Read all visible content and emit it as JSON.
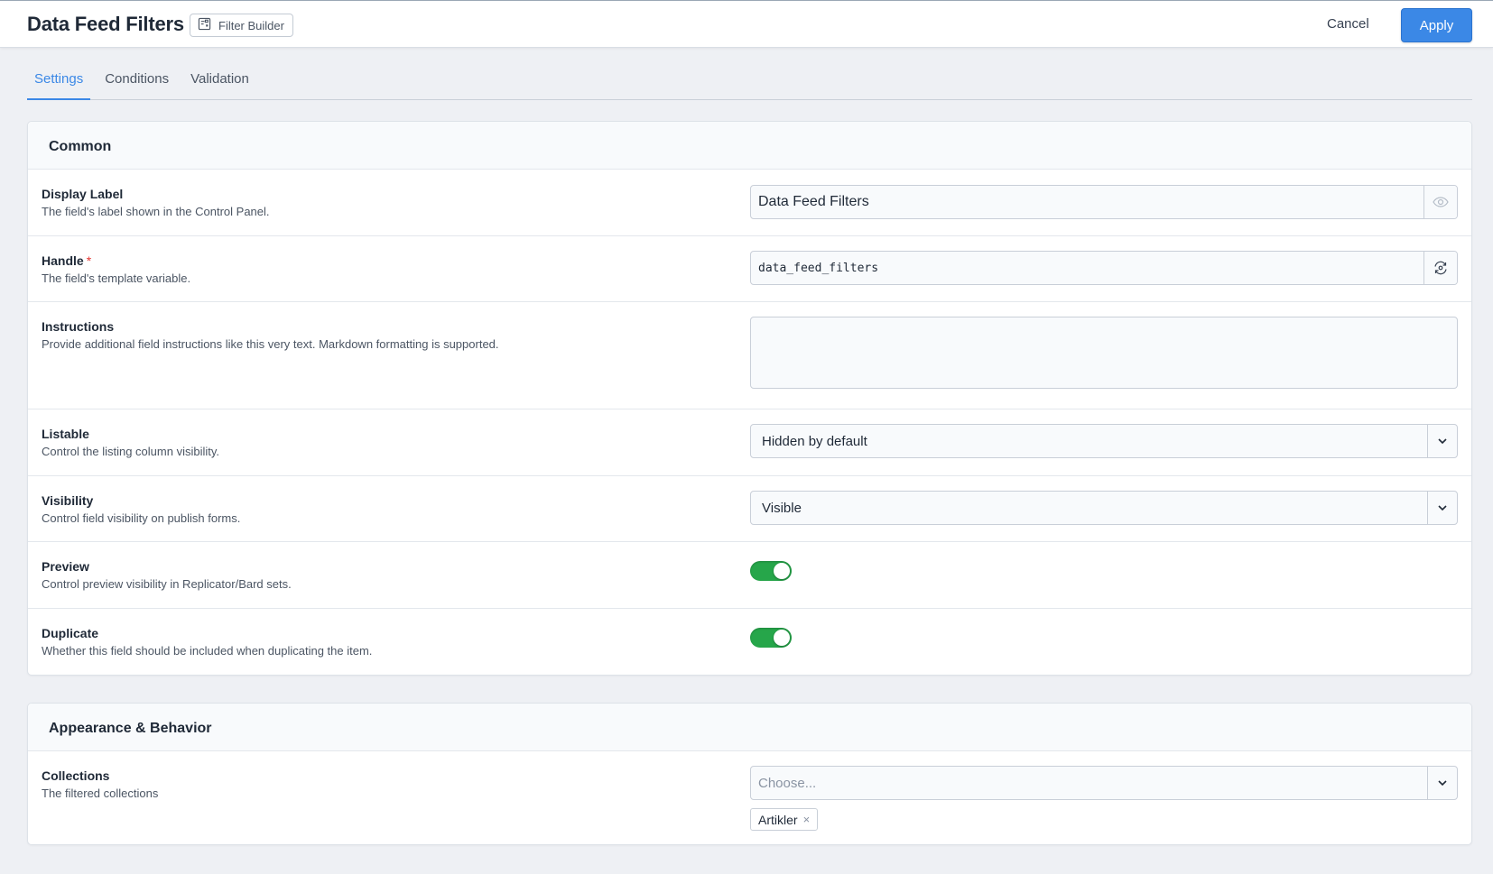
{
  "header": {
    "title": "Data Feed Filters",
    "fieldtype_label": "Filter Builder",
    "fieldtype_icon": "filter-builder-icon",
    "cancel_label": "Cancel",
    "apply_label": "Apply"
  },
  "tabs": [
    {
      "label": "Settings",
      "active": true
    },
    {
      "label": "Conditions",
      "active": false
    },
    {
      "label": "Validation",
      "active": false
    }
  ],
  "common": {
    "title": "Common",
    "display_label": {
      "label": "Display Label",
      "help": "The field's label shown in the Control Panel.",
      "value": "Data Feed Filters",
      "addon_icon": "eye-icon"
    },
    "handle": {
      "label": "Handle",
      "required_mark": "*",
      "help": "The field's template variable.",
      "value": "data_feed_filters",
      "addon_icon": "sync-icon"
    },
    "instructions": {
      "label": "Instructions",
      "help": "Provide additional field instructions like this very text. Markdown formatting is supported.",
      "value": ""
    },
    "listable": {
      "label": "Listable",
      "help": "Control the listing column visibility.",
      "value": "Hidden by default"
    },
    "visibility": {
      "label": "Visibility",
      "help": "Control field visibility on publish forms.",
      "value": "Visible"
    },
    "preview": {
      "label": "Preview",
      "help": "Control preview visibility in Replicator/Bard sets.",
      "on": true
    },
    "duplicate": {
      "label": "Duplicate",
      "help": "Whether this field should be included when duplicating the item.",
      "on": true
    }
  },
  "appearance": {
    "title": "Appearance & Behavior",
    "collections": {
      "label": "Collections",
      "help": "The filtered collections",
      "placeholder": "Choose...",
      "selected": [
        "Artikler"
      ],
      "remove_glyph": "×"
    }
  },
  "colors": {
    "accent": "#3b88e6",
    "toggle_on": "#26a64a",
    "required": "#e3342f"
  }
}
